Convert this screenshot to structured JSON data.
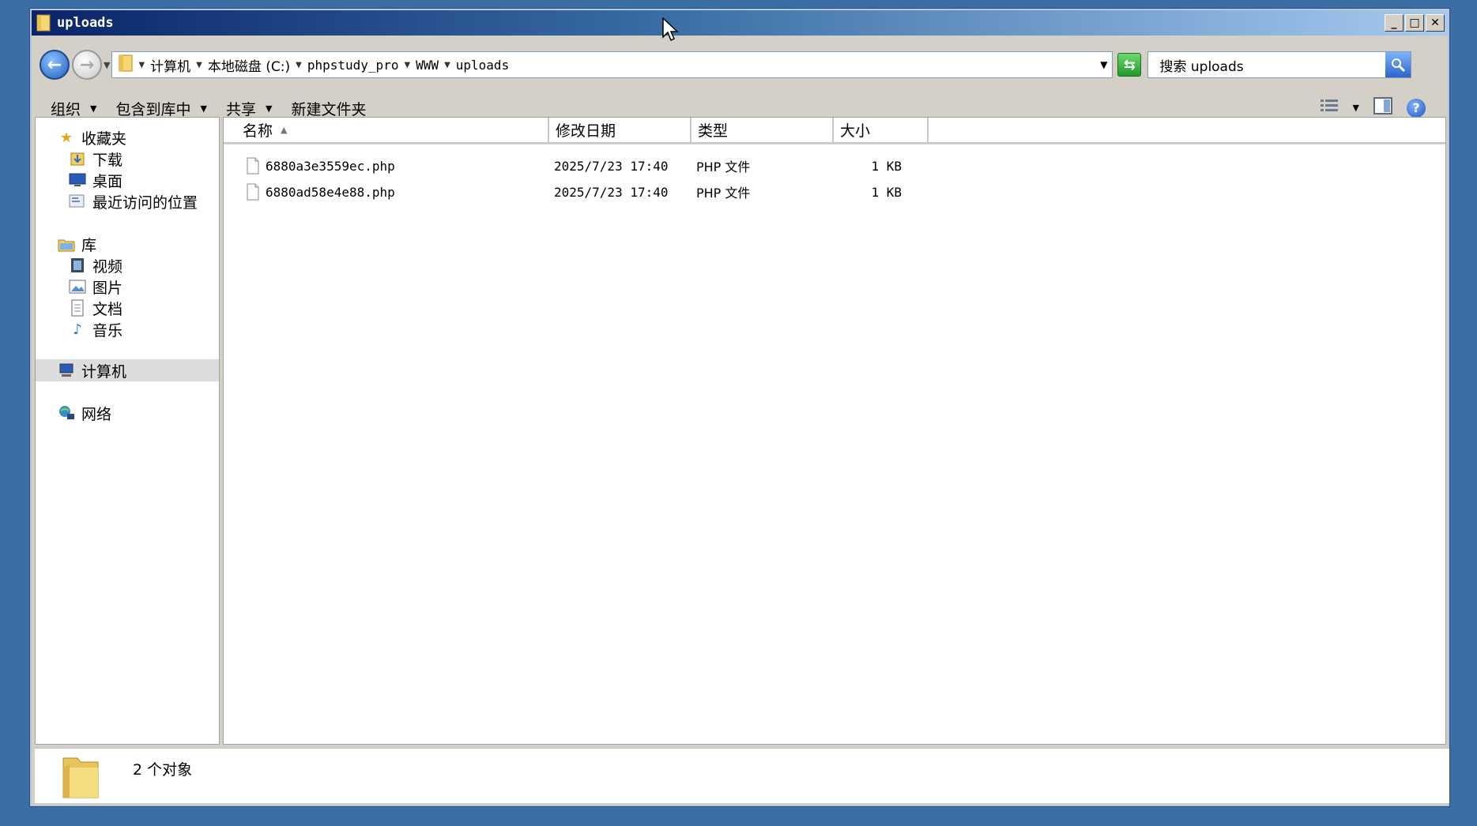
{
  "window": {
    "title": "uploads"
  },
  "address": {
    "crumbs": [
      "计算机",
      "本地磁盘 (C:)",
      "phpstudy_pro",
      "WWW",
      "uploads"
    ]
  },
  "search": {
    "placeholder": "搜索 uploads"
  },
  "toolbar": {
    "organize": "组织",
    "include_in_library": "包含到库中",
    "share": "共享",
    "new_folder": "新建文件夹"
  },
  "nav": {
    "favorites": "收藏夹",
    "downloads": "下载",
    "desktop": "桌面",
    "recent": "最近访问的位置",
    "libraries": "库",
    "videos": "视频",
    "pictures": "图片",
    "documents": "文档",
    "music": "音乐",
    "computer": "计算机",
    "network": "网络"
  },
  "columns": {
    "name": "名称",
    "date": "修改日期",
    "type": "类型",
    "size": "大小"
  },
  "files": [
    {
      "name": "6880a3e3559ec.php",
      "date": "2025/7/23 17:40",
      "type": "PHP 文件",
      "size": "1 KB"
    },
    {
      "name": "6880ad58e4e88.php",
      "date": "2025/7/23 17:40",
      "type": "PHP 文件",
      "size": "1 KB"
    }
  ],
  "status": {
    "count": "2 个对象"
  }
}
